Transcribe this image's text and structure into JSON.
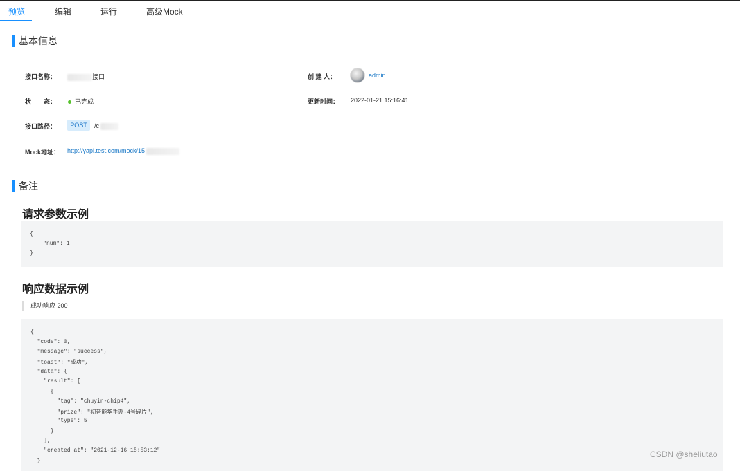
{
  "tabs": [
    {
      "label": "预览",
      "active": true
    },
    {
      "label": "编辑"
    },
    {
      "label": "运行"
    },
    {
      "label": "高级Mock"
    }
  ],
  "basic_info": {
    "title": "基本信息",
    "name_label": "接口名称：",
    "name_value": "接口",
    "creator_label": "创 建 人：",
    "creator_value": "admin",
    "status_label": "状　　态：",
    "status_value": "已完成",
    "status_color": "#57c22d",
    "updated_label": "更新时间：",
    "updated_value": "2022-01-21 15:16:41",
    "path_label": "接口路径：",
    "method": "POST",
    "path_value": "/c",
    "mock_label": "Mock地址：",
    "mock_value": "http://yapi.test.com/mock/15"
  },
  "remarks": {
    "title": "备注",
    "request_heading": "请求参数示例",
    "request_lines": [
      "{",
      "    \"num\": 1",
      "}"
    ],
    "response_heading": "响应数据示例",
    "response_status": "成功响应 200",
    "response_lines": [
      "{",
      "  \"code\": 0,",
      "  \"message\": \"success\",",
      "  \"toast\": \"成功\",",
      "  \"data\": {",
      "    \"result\": [",
      "      {",
      "        \"tag\": \"chuyin-chip4\",",
      "        \"prize\": \"初音能华手办-4号碎片\",",
      "        \"type\": 5",
      "      }",
      "    ],",
      "    \"created_at\": \"2021-12-16 15:53:12\"",
      "  }"
    ]
  },
  "watermark": "CSDN @sheliutao",
  "colors": {
    "accent": "#1890ff",
    "link": "#1877c6",
    "code_bg": "#f3f4f5"
  }
}
